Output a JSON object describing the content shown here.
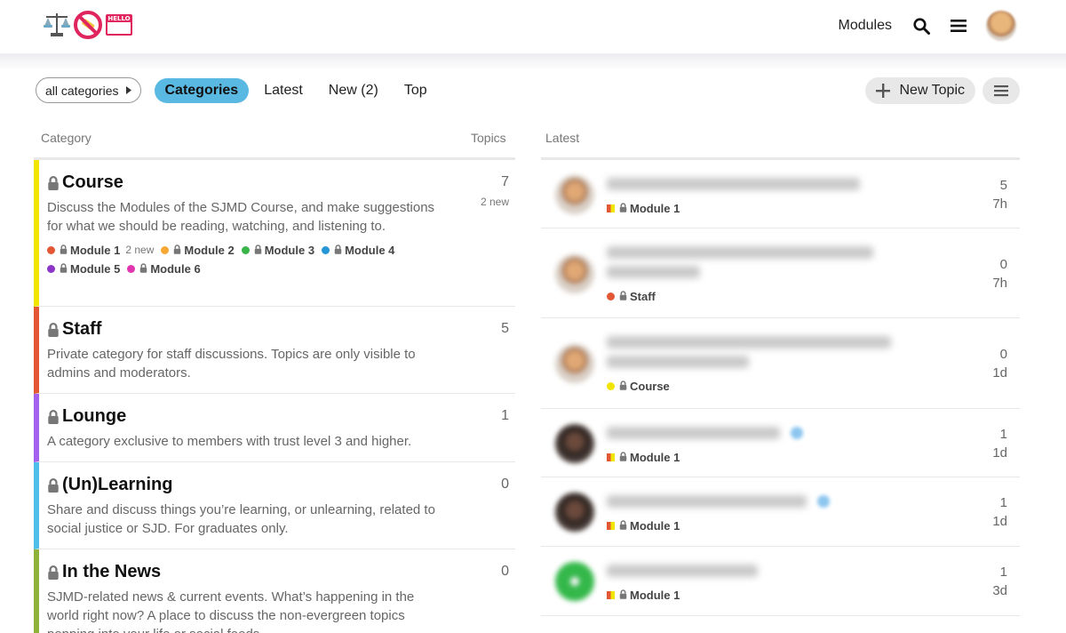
{
  "header": {
    "nav_link": "Modules",
    "icons": [
      "scales-icon",
      "no-symbol-icon",
      "hello-name-tag-icon",
      "search-icon",
      "hamburger-menu-icon"
    ]
  },
  "nav": {
    "category_dropdown": "all categories",
    "pills": [
      "Categories",
      "Latest",
      "New (2)",
      "Top"
    ],
    "active_pill": "Categories",
    "new_topic": "New Topic"
  },
  "columns": {
    "category": "Category",
    "topics": "Topics",
    "latest": "Latest"
  },
  "categories": [
    {
      "name": "Course",
      "color": "#f1e500",
      "topics": "7",
      "new": "2 new",
      "description": "Discuss the Modules of the SJMD Course, and make suggestions for what we should be reading, watching, and listening to.",
      "subcategories": [
        {
          "name": "Module 1",
          "color": "#e45735",
          "new": "2 new"
        },
        {
          "name": "Module 2",
          "color": "#f7a834",
          "new": ""
        },
        {
          "name": "Module 3",
          "color": "#3ab54a",
          "new": ""
        },
        {
          "name": "Module 4",
          "color": "#2596d6",
          "new": ""
        },
        {
          "name": "Module 5",
          "color": "#8c36c8",
          "new": ""
        },
        {
          "name": "Module 6",
          "color": "#e235b0",
          "new": ""
        }
      ]
    },
    {
      "name": "Staff",
      "color": "#e45735",
      "topics": "5",
      "new": "",
      "description": "Private category for staff discussions. Topics are only visible to admins and moderators.",
      "subcategories": []
    },
    {
      "name": "Lounge",
      "color": "#a461ef",
      "topics": "1",
      "new": "",
      "description": "A category exclusive to members with trust level 3 and higher.",
      "subcategories": []
    },
    {
      "name": "(Un)Learning",
      "color": "#4dbfe8",
      "topics": "0",
      "new": "",
      "description": "Share and discuss things you’re learning, or unlearning, related to social justice or SJD. For graduates only.",
      "subcategories": []
    },
    {
      "name": "In the News",
      "color": "#8fb23b",
      "topics": "0",
      "new": "",
      "description": "SJMD-related news & current events. What’s happening in the world right now? A place to discuss the non-evergreen topics popping into your life or social feeds.",
      "subcategories": []
    }
  ],
  "latest": [
    {
      "category": "Module 1",
      "cat_style": "split",
      "replies": "5",
      "age": "7h",
      "avatar": "tan"
    },
    {
      "category": "Staff",
      "cat_style": "dot",
      "cat_color": "#e45735",
      "replies": "0",
      "age": "7h",
      "avatar": "tan"
    },
    {
      "category": "Course",
      "cat_style": "dot",
      "cat_color": "#f1e500",
      "replies": "0",
      "age": "1d",
      "avatar": "tan"
    },
    {
      "category": "Module 1",
      "cat_style": "split",
      "replies": "1",
      "age": "1d",
      "avatar": "dark"
    },
    {
      "category": "Module 1",
      "cat_style": "split",
      "replies": "1",
      "age": "1d",
      "avatar": "dark"
    },
    {
      "category": "Module 1",
      "cat_style": "split",
      "replies": "1",
      "age": "3d",
      "avatar": "green"
    }
  ]
}
